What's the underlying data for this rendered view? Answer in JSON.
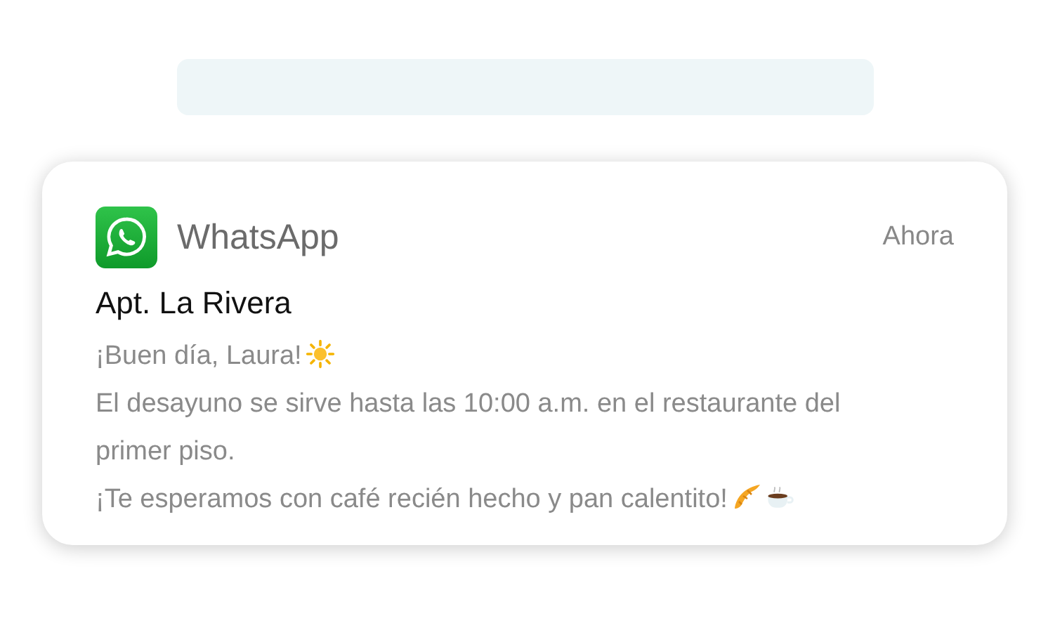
{
  "notification": {
    "app": "WhatsApp",
    "time": "Ahora",
    "title": "Apt. La Rivera",
    "lines": [
      {
        "text": "¡Buen día, Laura!",
        "icons": [
          {
            "kind": "sun"
          }
        ]
      },
      {
        "text": "El desayuno se sirve hasta las 10:00 a.m. en el restaurante del primer piso."
      },
      {
        "text": "¡Te esperamos con café recién hecho y pan calentito!",
        "icons": [
          {
            "kind": "croissant"
          },
          {
            "kind": "coffee"
          }
        ]
      }
    ]
  }
}
